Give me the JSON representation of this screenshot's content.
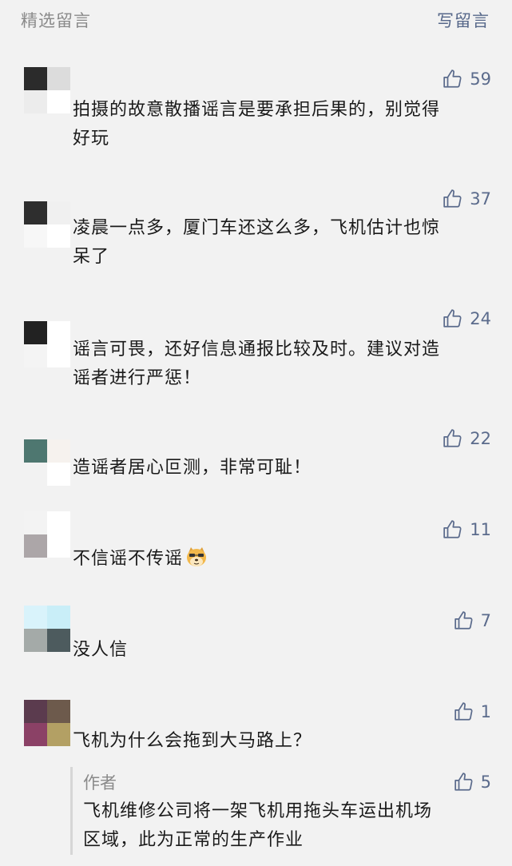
{
  "header": {
    "title": "精选留言",
    "write_comment": "写留言"
  },
  "comments": [
    {
      "likes": "59",
      "text_lines": [
        "拍摄的故意散播谣言是要承担后果的，别觉得",
        "好玩"
      ],
      "avatar_colors": [
        "#2b2b2b",
        "#dcdcdc",
        "#ececec",
        "#ffffff"
      ]
    },
    {
      "likes": "37",
      "text_lines": [
        "凌晨一点多，厦门车还这么多，飞机估计也惊",
        "呆了"
      ],
      "avatar_colors": [
        "#2e2e2e",
        "#f0f0f0",
        "#f7f7f7",
        "#ffffff"
      ]
    },
    {
      "likes": "24",
      "text_lines": [
        "谣言可畏，还好信息通报比较及时。建议对造",
        "谣者进行严惩！"
      ],
      "avatar_colors": [
        "#222222",
        "#ffffff",
        "#f4f4f4",
        "#ffffff"
      ]
    },
    {
      "likes": "22",
      "text_lines": [
        "造谣者居心叵测，非常可耻！"
      ],
      "avatar_colors": [
        "#4e7770",
        "#f6f2ee",
        "#f2f2f2",
        "#ffffff"
      ]
    },
    {
      "likes": "11",
      "text_lines": [
        "不信谣不传谣"
      ],
      "avatar_colors": [
        "#f3f3f3",
        "#ffffff",
        "#aca6a8",
        "#ffffff"
      ]
    },
    {
      "likes": "7",
      "text_lines": [
        "没人信"
      ],
      "avatar_colors": [
        "#d9f3fb",
        "#c9eef8",
        "#a4aaa8",
        "#4d5b5e"
      ]
    },
    {
      "likes": "1",
      "text_lines": [
        "飞机为什么会拖到大马路上？"
      ],
      "avatar_colors": [
        "#5b3b4e",
        "#6d5a4c",
        "#8b4166",
        "#b3a064"
      ]
    }
  ],
  "reply": {
    "author": "作者",
    "likes": "5",
    "text_lines": [
      "飞机维修公司将一架飞机用拖头车运出机场",
      "区域，此为正常的生产作业"
    ]
  },
  "icons": {
    "like": "thumbs-up-icon",
    "emoji": "doge-emoji"
  },
  "colors": {
    "link": "#57688a",
    "like": "#5b6b8c",
    "muted": "#8a8a8a",
    "background": "#f2f2f2"
  }
}
